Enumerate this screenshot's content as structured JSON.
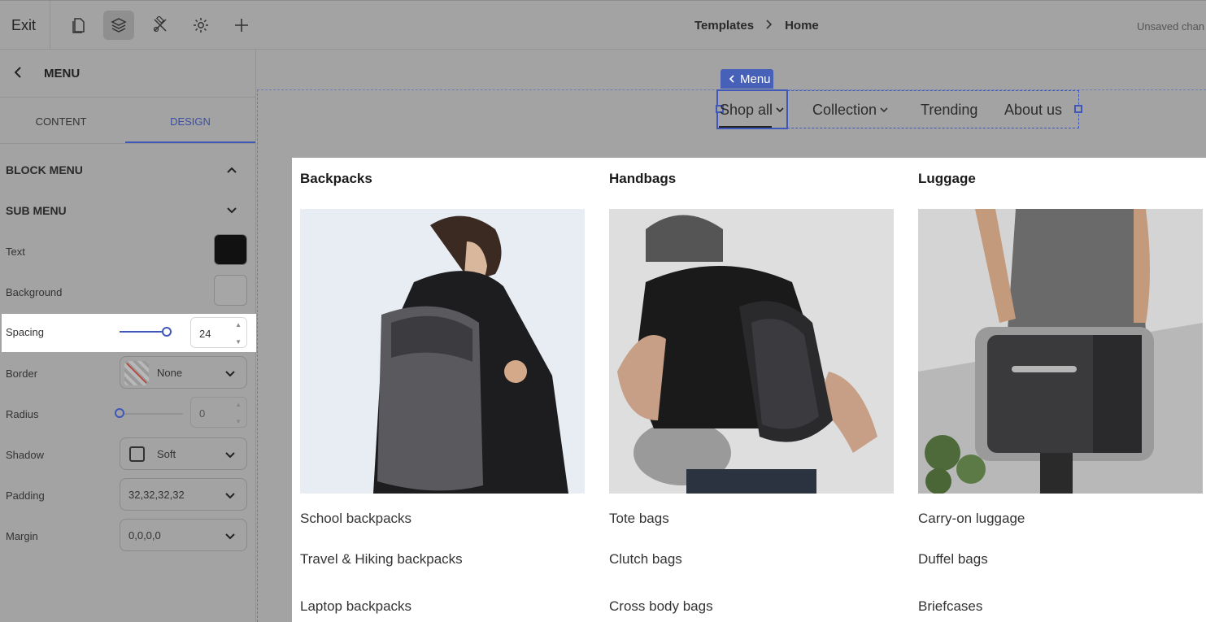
{
  "topbar": {
    "exit_label": "Exit",
    "icons": [
      "pages-icon",
      "layers-icon",
      "tools-icon",
      "settings-icon",
      "add-icon"
    ],
    "breadcrumb": [
      "Templates",
      "Home"
    ],
    "status": "Unsaved chan"
  },
  "panel": {
    "title": "MENU",
    "tabs": [
      "CONTENT",
      "DESIGN"
    ],
    "active_tab": "DESIGN",
    "sections": [
      "BLOCK MENU",
      "SUB MENU"
    ],
    "props": {
      "text_label": "Text",
      "text_color": "#111111",
      "background_label": "Background",
      "spacing_label": "Spacing",
      "spacing_value": "24",
      "border_label": "Border",
      "border_value": "None",
      "radius_label": "Radius",
      "radius_value": "0",
      "shadow_label": "Shadow",
      "shadow_value": "Soft",
      "padding_label": "Padding",
      "padding_value": "32,32,32,32",
      "margin_label": "Margin",
      "margin_value": "0,0,0,0"
    }
  },
  "canvas": {
    "menu_tag": "Menu",
    "nav": [
      "Shop all",
      "Collection",
      "Trending",
      "About us"
    ],
    "columns": [
      {
        "title": "Backpacks",
        "image": "man-with-backpack-photo",
        "links": [
          "School backpacks",
          "Travel & Hiking backpacks",
          "Laptop backpacks"
        ]
      },
      {
        "title": "Handbags",
        "image": "sling-bag-photo",
        "links": [
          "Tote bags",
          "Clutch bags",
          "Cross body bags"
        ]
      },
      {
        "title": "Luggage",
        "image": "carry-case-photo",
        "links": [
          "Carry-on luggage",
          "Duffel bags",
          "Briefcases"
        ]
      }
    ]
  },
  "colors": {
    "accent": "#3f57b8",
    "overlay": "#a3a3a3"
  }
}
